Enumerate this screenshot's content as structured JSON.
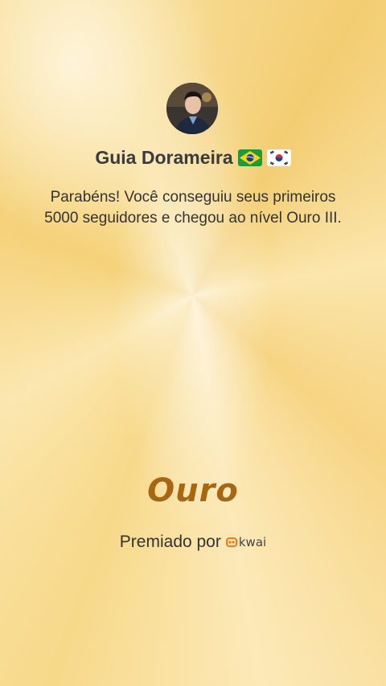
{
  "profile": {
    "name": "Guia Dorameira",
    "flags": [
      "brazil-flag-icon",
      "south-korea-flag-icon"
    ]
  },
  "message": "Parabéns! Você conseguiu seus primeiros 5000 seguidores e chegou ao nível Ouro III.",
  "level": {
    "label": "Ouro",
    "color": "#a86512"
  },
  "award": {
    "label": "Premiado por",
    "brand": "kwai",
    "brand_color": "#ff6a00"
  },
  "colors": {
    "background_gold": "#f7d98a",
    "text": "#333333"
  }
}
